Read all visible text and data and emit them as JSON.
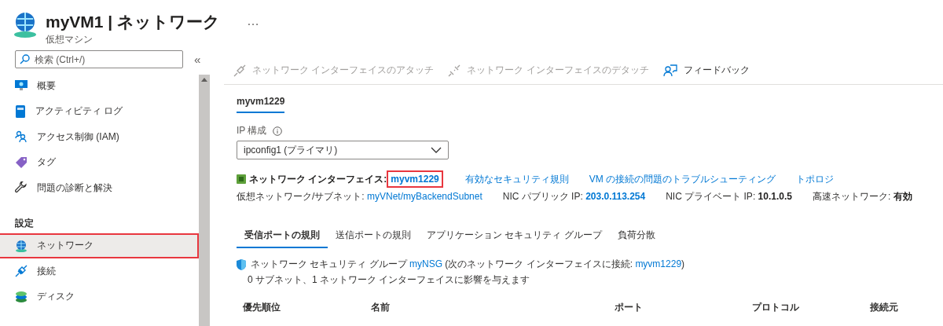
{
  "header": {
    "title": "myVM1 | ネットワーク",
    "subtitle": "仮想マシン",
    "more": "…"
  },
  "sidebar": {
    "search": {
      "placeholder": "検索 (Ctrl+/)"
    },
    "collapse": "«",
    "items": [
      {
        "kind": "item",
        "label": "概要",
        "selected": false,
        "highlighted": false
      },
      {
        "kind": "item",
        "label": "アクティビティ ログ",
        "selected": false,
        "highlighted": false
      },
      {
        "kind": "item",
        "label": "アクセス制御 (IAM)",
        "selected": false,
        "highlighted": false
      },
      {
        "kind": "item",
        "label": "タグ",
        "selected": false,
        "highlighted": false
      },
      {
        "kind": "item",
        "label": "問題の診断と解決",
        "selected": false,
        "highlighted": false
      },
      {
        "kind": "section",
        "label": "設定"
      },
      {
        "kind": "item",
        "label": "ネットワーク",
        "selected": true,
        "highlighted": true
      },
      {
        "kind": "item",
        "label": "接続",
        "selected": false,
        "highlighted": false
      },
      {
        "kind": "item",
        "label": "ディスク",
        "selected": false,
        "highlighted": false
      }
    ]
  },
  "toolbar": [
    {
      "label": "ネットワーク インターフェイスのアタッチ",
      "disabled": true
    },
    {
      "label": "ネットワーク インターフェイスのデタッチ",
      "disabled": true
    },
    {
      "label": "フィードバック",
      "disabled": false
    }
  ],
  "nic_tabs": [
    {
      "label": "myvm1229",
      "selected": true
    }
  ],
  "ip_config": {
    "label": "IP 構成",
    "value": "ipconfig1 (プライマリ)"
  },
  "nic": {
    "label": "ネットワーク インターフェイス:",
    "name": "myvm1229",
    "highlighted": true,
    "links": [
      "有効なセキュリティ規則",
      "VM の接続の問題のトラブルシューティング",
      "トポロジ"
    ]
  },
  "details": [
    {
      "label": "仮想ネットワーク/サブネット:",
      "value": "myVNet/myBackendSubnet",
      "kind": "link"
    },
    {
      "label": "NIC パブリック IP:",
      "value": "203.0.113.254",
      "kind": "boldlink"
    },
    {
      "label": "NIC プライベート IP:",
      "value": "10.1.0.5",
      "kind": "bold"
    },
    {
      "label": "高速ネットワーク:",
      "value": "有効",
      "kind": "bold"
    }
  ],
  "rule_tabs": [
    {
      "label": "受信ポートの規則",
      "selected": true
    },
    {
      "label": "送信ポートの規則",
      "selected": false
    },
    {
      "label": "アプリケーション セキュリティ グループ",
      "selected": false
    },
    {
      "label": "負荷分散",
      "selected": false
    }
  ],
  "nsg": {
    "prefix": "ネットワーク セキュリティ グループ",
    "name": "myNSG",
    "middle": "(次のネットワーク インターフェイスに接続:",
    "nic": "myvm1229",
    "suffix": ")",
    "impact": "0 サブネット、1 ネットワーク インターフェイスに影響を与えます"
  },
  "table": {
    "columns": [
      "優先順位",
      "名前",
      "ポート",
      "プロトコル",
      "接続元"
    ]
  }
}
